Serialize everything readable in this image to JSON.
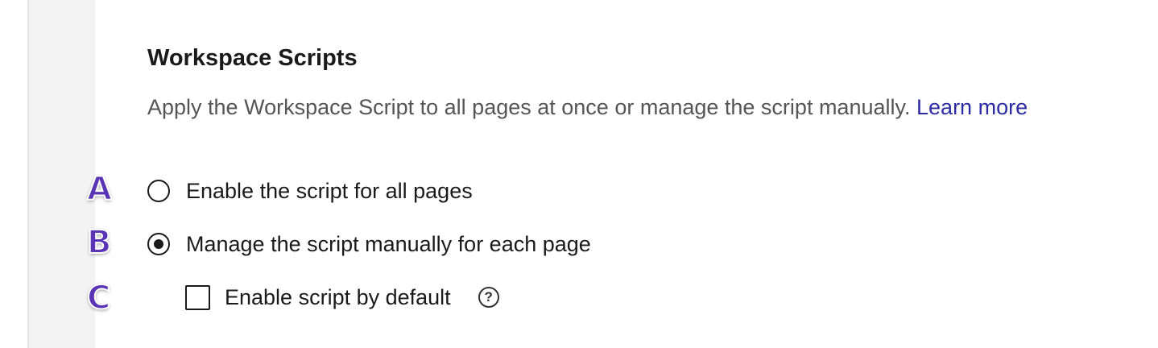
{
  "section": {
    "title": "Workspace Scripts",
    "description": "Apply the Workspace Script to all pages at once or manage the script manually.",
    "learn_more": "Learn more"
  },
  "options": {
    "all_pages": {
      "label": "Enable the script for all pages",
      "selected": false
    },
    "manual": {
      "label": "Manage the script manually for each page",
      "selected": true
    },
    "default_enable": {
      "label": "Enable script by default",
      "checked": false
    }
  },
  "help_icon": {
    "icon": "question-circle-icon",
    "glyph": "?"
  },
  "annotations": {
    "a": "A",
    "b": "B",
    "c": "C",
    "color": "#5a34b4"
  }
}
